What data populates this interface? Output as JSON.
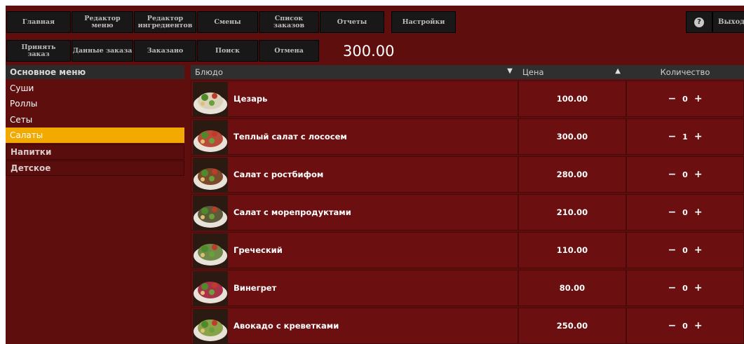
{
  "toolbar": {
    "row1": [
      "Главная",
      "Редактор\nменю",
      "Редактор\nингредиентов",
      "Смены",
      "Список\nзаказов",
      "Отчеты",
      "Настройки"
    ],
    "row2": [
      "Принять\nзаказ",
      "Данные заказа",
      "Заказано",
      "Поиск",
      "Отмена"
    ],
    "order_total": "300.00",
    "help_icon": "question-icon",
    "logout_label": "Выход"
  },
  "menu": {
    "header": "Основное меню",
    "items": [
      {
        "label": "Суши",
        "state": "normal"
      },
      {
        "label": "Роллы",
        "state": "normal"
      },
      {
        "label": "Сеты",
        "state": "normal"
      },
      {
        "label": "Салаты",
        "state": "active"
      },
      {
        "label": "Напитки",
        "state": "boxed"
      },
      {
        "label": "Детское",
        "state": "boxed"
      }
    ]
  },
  "table": {
    "columns": {
      "dish": "Блюдо",
      "price": "Цена",
      "quantity": "Количество"
    },
    "rows": [
      {
        "name": "Цезарь",
        "price": "100.00",
        "qty": "0",
        "thumb_color": "#d9d2b8"
      },
      {
        "name": "Теплый салат с лососем",
        "price": "300.00",
        "qty": "1",
        "thumb_color": "#b94b3a"
      },
      {
        "name": "Салат с ростбифом",
        "price": "280.00",
        "qty": "0",
        "thumb_color": "#7a4a2a"
      },
      {
        "name": "Салат с морепродуктами",
        "price": "210.00",
        "qty": "0",
        "thumb_color": "#5c5a3a"
      },
      {
        "name": "Греческий",
        "price": "110.00",
        "qty": "0",
        "thumb_color": "#6f8a4a"
      },
      {
        "name": "Винегрет",
        "price": "80.00",
        "qty": "0",
        "thumb_color": "#a8324a"
      },
      {
        "name": "Авокадо с креветками",
        "price": "250.00",
        "qty": "0",
        "thumb_color": "#8aa34a"
      }
    ],
    "minus_label": "−",
    "plus_label": "+"
  },
  "colors": {
    "background": "#5f0e0e",
    "row": "#6b0f10",
    "toolbar_button": "#181818",
    "active_menu": "#f2a900"
  }
}
